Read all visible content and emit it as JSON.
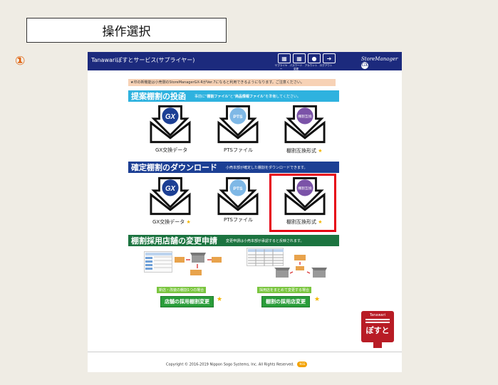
{
  "header": {
    "title": "操作選択",
    "step_marker": "①"
  },
  "app": {
    "title": "Tanawariぽすとサービス(サプライヤー)",
    "toolbar_labels": [
      "サプライヤー",
      "パスワード変更",
      "アカウント",
      "ログアウト"
    ],
    "brand": "StoreManager",
    "brand_sub": "GX"
  },
  "notice": "★印の新機能は小売側のStoreManagerGX-RがVer.7になると利用できるようになります。ご注意ください。",
  "sections": {
    "proposal": {
      "heading": "提案棚割の投函",
      "desc_pre": "事前に\"",
      "desc_b1": "棚割ファイル",
      "desc_mid": "\"と\"",
      "desc_b2": "商品情報ファイル",
      "desc_post": "\"を準備してください。",
      "items": [
        {
          "icon_label": "GX",
          "caption": "GX交換データ",
          "star": false
        },
        {
          "icon_label": "PTS",
          "caption": "PTSファイル",
          "star": false
        },
        {
          "icon_label": "棚割互換",
          "caption": "棚割互換形式",
          "star": true
        }
      ]
    },
    "confirmed": {
      "heading": "確定棚割のダウンロード",
      "desc": "小売本部が確定した棚割をダウンロードできます。",
      "items": [
        {
          "icon_label": "GX",
          "caption": "GX交換データ",
          "star": true
        },
        {
          "icon_label": "PTS",
          "caption": "PTSファイル",
          "star": false
        },
        {
          "icon_label": "棚割互換",
          "caption": "棚割互換形式",
          "star": true
        }
      ]
    },
    "store_change": {
      "heading": "棚割採用店舗の変更申請",
      "desc": "変更申請は小売本部が承認すると反映されます。",
      "left_tag": "新店・改装の棚割1つの場合",
      "left_button": "店舗の採用棚割変更",
      "right_tag": "採用店をまとめて変更する場合",
      "right_button": "棚割の採用店変更",
      "star": "★"
    }
  },
  "posuto": {
    "small": "Tanawari",
    "big": "ぽすと"
  },
  "footer": {
    "copyright": "Copyright © 2016-2019 Nippon Sogo Systems, Inc. All Rights Reserved.",
    "logo": "NSS"
  },
  "colors": {
    "topbar": "#1c2a7d",
    "sec1": "#2eb2df",
    "sec2": "#1c3f94",
    "sec3": "#1c7440",
    "highlight": "#e60012"
  }
}
